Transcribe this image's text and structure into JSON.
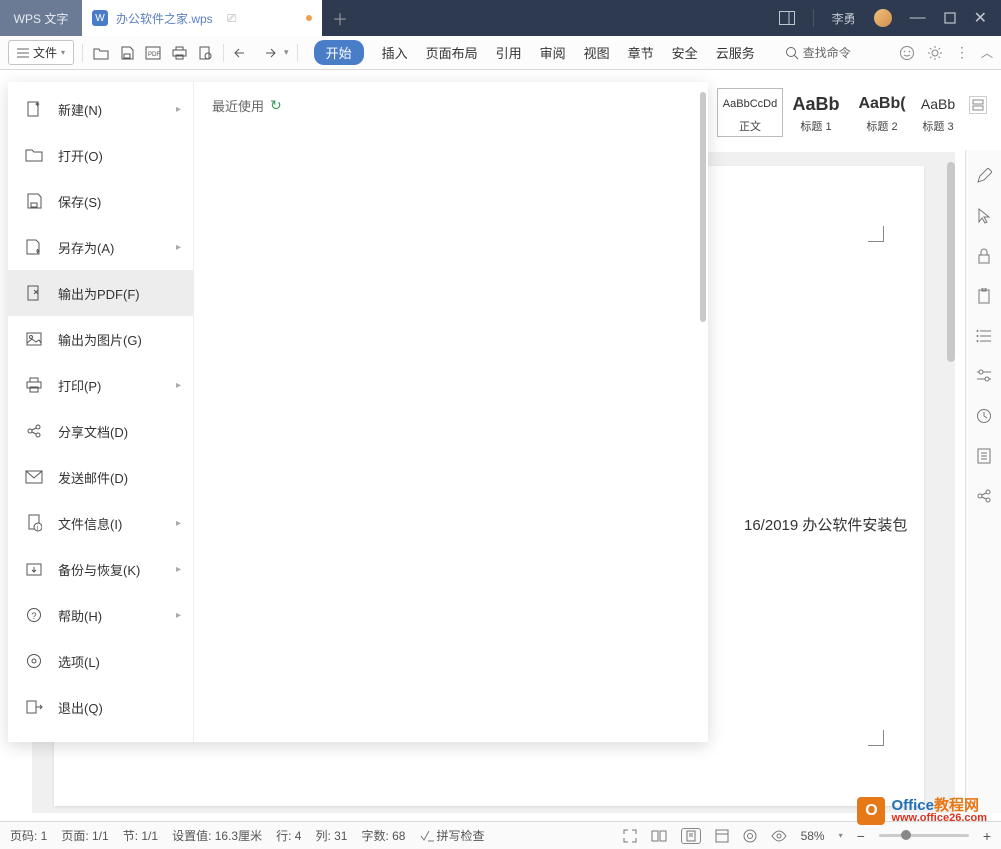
{
  "titlebar": {
    "app_name": "WPS 文字",
    "doc_name": "办公软件之家.wps",
    "user_name": "李勇"
  },
  "toolbar": {
    "file_label": "文件",
    "search_label": "查找命令"
  },
  "ribbon": {
    "tabs": [
      "开始",
      "插入",
      "页面布局",
      "引用",
      "审阅",
      "视图",
      "章节",
      "安全",
      "云服务"
    ]
  },
  "styles": [
    {
      "preview": "AaBbCcDd",
      "label": "正文",
      "size": "11px",
      "weight": "normal"
    },
    {
      "preview": "AaBb",
      "label": "标题 1",
      "size": "18px",
      "weight": "bold"
    },
    {
      "preview": "AaBb(",
      "label": "标题 2",
      "size": "16px",
      "weight": "bold"
    },
    {
      "preview": "AaBb",
      "label": "标题 3",
      "size": "14px",
      "weight": "normal"
    }
  ],
  "file_menu": {
    "recent_label": "最近使用",
    "items": [
      {
        "label": "新建(N)",
        "arrow": true
      },
      {
        "label": "打开(O)",
        "arrow": false
      },
      {
        "label": "保存(S)",
        "arrow": false
      },
      {
        "label": "另存为(A)",
        "arrow": true
      },
      {
        "label": "输出为PDF(F)",
        "arrow": false
      },
      {
        "label": "输出为图片(G)",
        "arrow": false
      },
      {
        "label": "打印(P)",
        "arrow": true
      },
      {
        "label": "分享文档(D)",
        "arrow": false
      },
      {
        "label": "发送邮件(D)",
        "arrow": false
      },
      {
        "label": "文件信息(I)",
        "arrow": true
      },
      {
        "label": "备份与恢复(K)",
        "arrow": true
      },
      {
        "label": "帮助(H)",
        "arrow": true
      },
      {
        "label": "选项(L)",
        "arrow": false
      },
      {
        "label": "退出(Q)",
        "arrow": false
      }
    ]
  },
  "document": {
    "visible_text": "16/2019 办公软件安装包"
  },
  "statusbar": {
    "page_no": "页码: 1",
    "page_of": "页面: 1/1",
    "section": "节: 1/1",
    "setting": "设置值: 16.3厘米",
    "row": "行: 4",
    "col": "列: 31",
    "chars": "字数: 68",
    "spell": "拼写检查",
    "zoom": "58%"
  },
  "watermark": {
    "line1_a": "Office",
    "line1_b": "教程网",
    "line2": "www.office26.com"
  }
}
